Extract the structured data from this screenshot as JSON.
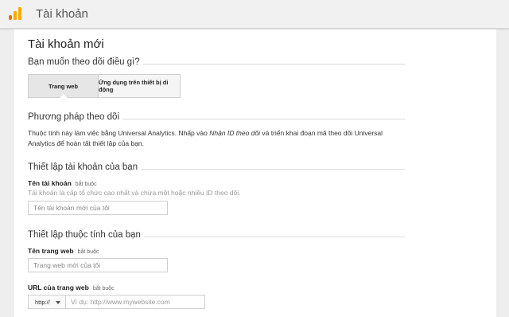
{
  "header": {
    "title": "Tài khoản",
    "logo": "analytics-logo-icon",
    "logo_colors": [
      "#f9ab00",
      "#e37400"
    ]
  },
  "page": {
    "title": "Tài khoản mới"
  },
  "track": {
    "question": "Bạn muốn theo dõi điều gì?",
    "options": [
      {
        "label": "Trang web",
        "selected": true
      },
      {
        "label": "Ứng dụng trên thiết bị di động",
        "selected": false
      }
    ]
  },
  "method": {
    "heading": "Phương pháp theo dõi",
    "text_before": "Thuộc tính này làm việc bằng Universal Analytics. Nhấp vào ",
    "text_em": "Nhận ID theo dõi",
    "text_after": " và triển khai đoạn mã theo dõi Universal Analytics để hoàn tất thiết lập của bạn."
  },
  "account": {
    "heading": "Thiết lập tài khoản của bạn",
    "name_label": "Tên tài khoản",
    "required": "bắt buộc",
    "hint": "Tài khoản là cấp tổ chức cao nhất và chứa một hoặc nhiều ID theo dõi.",
    "name_placeholder": "Tên tài khoản mới của tôi"
  },
  "property": {
    "heading": "Thiết lập thuộc tính của bạn",
    "site_label": "Tên trang web",
    "required": "bắt buộc",
    "site_placeholder": "Trang web mới của tôi",
    "url_label": "URL của trang web",
    "url_required": "bắt buộc",
    "protocol": "http://",
    "url_placeholder": "Ví dụ: http://www.mywebsite.com"
  }
}
